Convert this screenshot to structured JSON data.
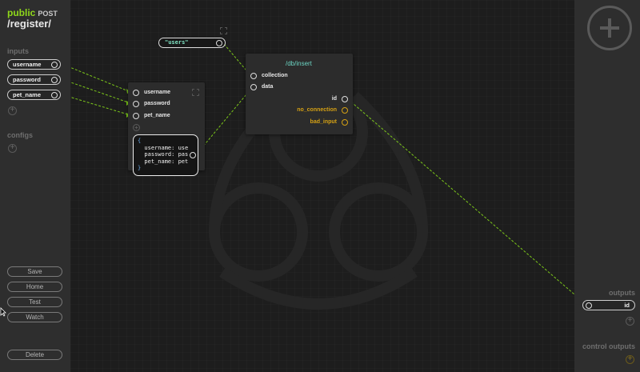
{
  "route": {
    "access": "public",
    "method": "POST",
    "path": "/register/"
  },
  "sidebar_left": {
    "inputs_label": "inputs",
    "inputs": [
      "username",
      "password",
      "pet_name"
    ],
    "configs_label": "configs",
    "buttons": {
      "save": "Save",
      "home": "Home",
      "test": "Test",
      "watch": "Watch",
      "delete": "Delete"
    }
  },
  "canvas": {
    "string_node": {
      "value": "\"users\""
    },
    "object_node": {
      "inputs": [
        "username",
        "password",
        "pet_name"
      ],
      "code_lines": [
        "{",
        "  username: use",
        "  password: pas",
        "  pet_name: pet",
        "}"
      ]
    },
    "insert_node": {
      "title": "/db/insert",
      "inputs": [
        "collection",
        "data"
      ],
      "outputs": [
        {
          "label": "id",
          "color": "#e6e6e6"
        },
        {
          "label": "no_connection",
          "color": "#d4a014"
        },
        {
          "label": "bad_input",
          "color": "#d4a014"
        }
      ]
    }
  },
  "sidebar_right": {
    "outputs_label": "outputs",
    "outputs": [
      "id"
    ],
    "control_outputs_label": "control outputs"
  },
  "colors": {
    "accent": "#8fd81b",
    "wire": "#7cc71a",
    "warn": "#d4a014",
    "teal": "#6bd2c1"
  }
}
